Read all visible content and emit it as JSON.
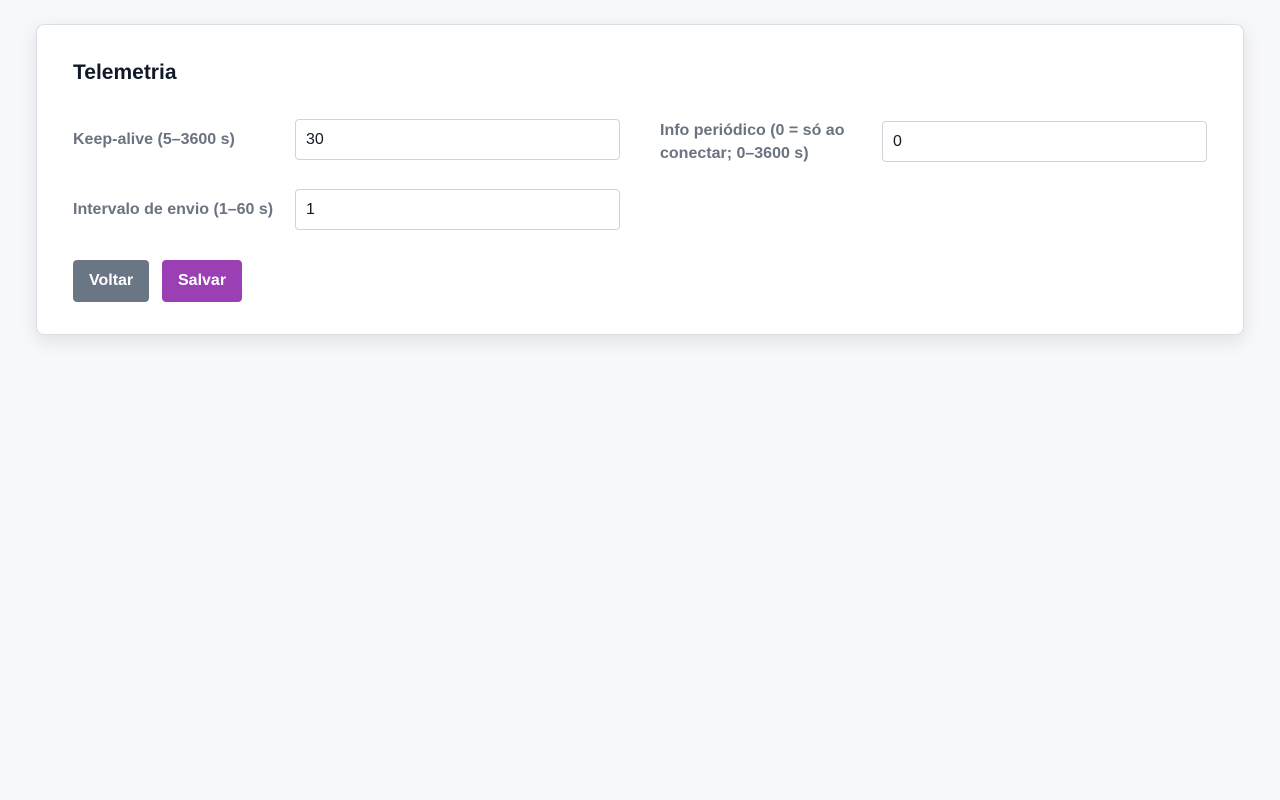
{
  "form": {
    "title": "Telemetria",
    "fields": {
      "keepalive": {
        "label": "Keep-alive (5–3600 s)",
        "value": "30"
      },
      "info_periodico": {
        "label": "Info periódico (0 = só ao conectar; 0–3600 s)",
        "value": "0"
      },
      "intervalo_envio": {
        "label": "Intervalo de envio (1–60 s)",
        "value": "1"
      }
    },
    "buttons": {
      "back_label": "Voltar",
      "save_label": "Salvar"
    }
  },
  "colors": {
    "background": "#f7f8fa",
    "card": "#ffffff",
    "label": "#6b7280",
    "back_button": "#6b7685",
    "save_button": "#9b3fb5"
  }
}
